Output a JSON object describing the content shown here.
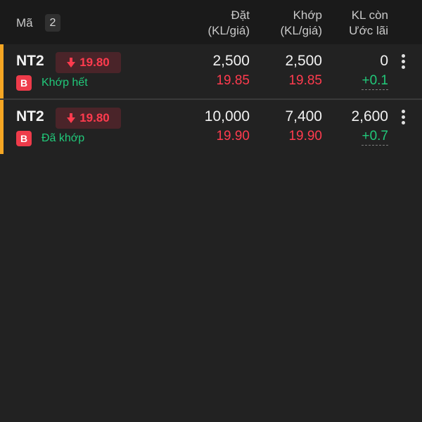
{
  "header": {
    "ma_label": "Mã",
    "count": "2",
    "col_dat": [
      "Đặt",
      "(KL/giá)"
    ],
    "col_khop": [
      "Khớp",
      "(KL/giá)"
    ],
    "col_kl": [
      "KL còn",
      "Ước lãi"
    ]
  },
  "orders": [
    {
      "symbol": "NT2",
      "price_badge": "19.80",
      "price_direction": "down",
      "side": "B",
      "status": "Khớp hết",
      "dat_qty": "2,500",
      "dat_price": "19.85",
      "khop_qty": "2,500",
      "khop_price": "19.85",
      "remaining": "0",
      "est_profit": "+0.1"
    },
    {
      "symbol": "NT2",
      "price_badge": "19.80",
      "price_direction": "down",
      "side": "B",
      "status": "Đã khớp",
      "dat_qty": "10,000",
      "dat_price": "19.90",
      "khop_qty": "7,400",
      "khop_price": "19.90",
      "remaining": "2,600",
      "est_profit": "+0.7"
    }
  ],
  "colors": {
    "accent": "#f5a623",
    "down_red": "#ff3b4e",
    "up_green": "#21c97a",
    "background": "#222222"
  }
}
